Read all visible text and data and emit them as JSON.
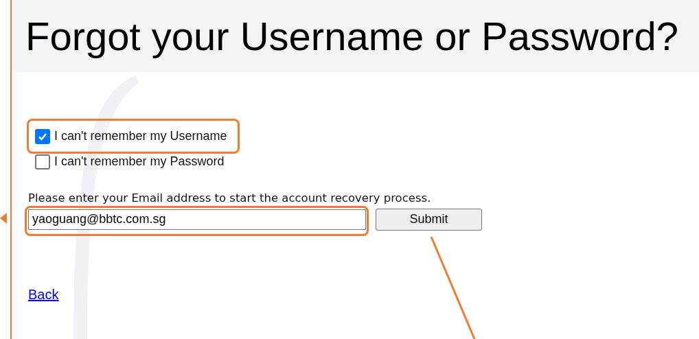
{
  "page": {
    "title": "Forgot your Username or Password?"
  },
  "options": [
    {
      "label": "I can't remember my Username",
      "checked": true
    },
    {
      "label": "I can't remember my Password",
      "checked": false
    }
  ],
  "instructions": "Please enter your Email address to start the account recovery process.",
  "email": {
    "value": "yaoguang@bbtc.com.sg"
  },
  "submit": "Submit",
  "back_link": "Back"
}
